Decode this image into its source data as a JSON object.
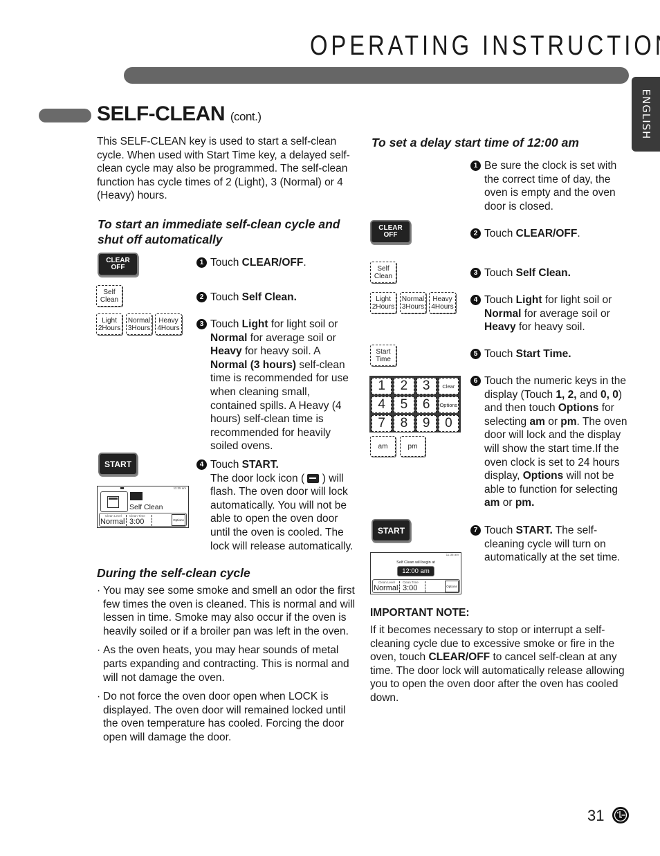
{
  "header": {
    "title": "OPERATING INSTRUCTIONS",
    "language_tab": "ENGLISH"
  },
  "section": {
    "title": "SELF-CLEAN",
    "title_suffix": "(cont.)",
    "intro": "This SELF-CLEAN key is used to start a self-clean cycle. When used with Start Time key, a delayed self-clean cycle may also be programmed. The self-clean function has cycle times of 2 (Light), 3 (Normal) or 4 (Heavy) hours."
  },
  "immediate": {
    "heading": "To start an immediate self-clean cycle and shut off automatically",
    "steps": [
      {
        "num": "1",
        "pre": "Touch ",
        "bold": "CLEAR/OFF",
        "post": "."
      },
      {
        "num": "2",
        "pre": "Touch ",
        "bold": "Self Clean.",
        "post": ""
      },
      {
        "num": "3",
        "html_parts": [
          [
            "",
            "Touch "
          ],
          [
            "b",
            "Light"
          ],
          [
            "",
            " for light soil or "
          ],
          [
            "b",
            "Normal"
          ],
          [
            "",
            " for average soil or "
          ],
          [
            "b",
            "Heavy"
          ],
          [
            "",
            " for heavy soil. A "
          ],
          [
            "b",
            "Normal (3 hours)"
          ],
          [
            "",
            " self-clean time is recommended for use when cleaning small, contained spills. A Heavy (4 hours) self-clean time is recommended for heavily soiled ovens."
          ]
        ]
      },
      {
        "num": "4",
        "line1_pre": "Touch ",
        "line1_bold": "START.",
        "body_pre": "The door lock icon ( ",
        "body_post": " ) will flash. The oven door will lock automatically. You will not be able to open the oven door until the oven is cooled. The lock will release automatically."
      }
    ],
    "buttons": {
      "clear_off": [
        "CLEAR",
        "OFF"
      ],
      "self_clean": [
        "Self",
        "Clean"
      ],
      "light": [
        "Light",
        "2Hours"
      ],
      "normal": [
        "Normal",
        "3Hours"
      ],
      "heavy": [
        "Heavy",
        "4Hours"
      ],
      "start": "START"
    },
    "display": {
      "clock": "11:35 am",
      "mode": "Self Clean",
      "clean_level_label": "Clean Level",
      "clean_level": "Normal",
      "clean_time_label": "Clean Time",
      "clean_time": "3:00",
      "options": "Options"
    }
  },
  "during": {
    "heading": "During the self-clean cycle",
    "bullets": [
      "You may see some smoke and smell an odor the first few times the oven is cleaned. This is normal and will lessen in time. Smoke may also occur if the oven is heavily soiled or if a broiler pan was left in the oven.",
      "As the oven heats, you may hear sounds of metal parts expanding and contracting. This is normal and will not damage the oven.",
      "Do not force the oven door open when LOCK is displayed. The oven door will remained locked until the oven temperature has cooled. Forcing the door open will damage the door."
    ]
  },
  "delay": {
    "heading": "To set a delay start time of 12:00 am",
    "steps": [
      {
        "num": "1",
        "parts": [
          [
            "",
            "Be sure the clock is set with the correct time of day, the oven is empty and the oven door is closed."
          ]
        ]
      },
      {
        "num": "2",
        "parts": [
          [
            "",
            "Touch "
          ],
          [
            "b",
            "CLEAR/OFF"
          ],
          [
            "",
            "."
          ]
        ]
      },
      {
        "num": "3",
        "parts": [
          [
            "",
            "Touch "
          ],
          [
            "b",
            "Self Clean."
          ]
        ]
      },
      {
        "num": "4",
        "parts": [
          [
            "",
            "Touch "
          ],
          [
            "b",
            "Light"
          ],
          [
            "",
            " for light soil or "
          ],
          [
            "b",
            "Normal"
          ],
          [
            "",
            " for average soil or "
          ],
          [
            "b",
            "Heavy"
          ],
          [
            "",
            " for heavy soil."
          ]
        ]
      },
      {
        "num": "5",
        "parts": [
          [
            "",
            "Touch "
          ],
          [
            "b",
            "Start Time."
          ]
        ]
      },
      {
        "num": "6",
        "parts": [
          [
            "",
            "Touch the numeric keys in the display (Touch "
          ],
          [
            "b",
            "1, 2,"
          ],
          [
            "",
            " and "
          ],
          [
            "b",
            "0, 0"
          ],
          [
            "",
            ") and then touch "
          ],
          [
            "b",
            "Options"
          ],
          [
            "",
            " for selecting "
          ],
          [
            "b",
            "am"
          ],
          [
            "",
            " or "
          ],
          [
            "b",
            "pm"
          ],
          [
            "",
            ". The oven door will lock and the display will show the start time.If the oven clock is set to 24 hours display, "
          ],
          [
            "b",
            "Options"
          ],
          [
            "",
            " will not be able to function for selecting "
          ],
          [
            "b",
            "am"
          ],
          [
            "",
            " or "
          ],
          [
            "b",
            "pm."
          ]
        ]
      },
      {
        "num": "7",
        "parts": [
          [
            "",
            "Touch "
          ],
          [
            "b",
            "START."
          ],
          [
            "",
            " The self-cleaning cycle will turn on automatically at the set time."
          ]
        ]
      }
    ],
    "buttons": {
      "clear_off": [
        "CLEAR",
        "OFF"
      ],
      "self_clean": [
        "Self",
        "Clean"
      ],
      "light": [
        "Light",
        "2Hours"
      ],
      "normal": [
        "Normal",
        "3Hours"
      ],
      "heavy": [
        "Heavy",
        "4Hours"
      ],
      "start_time": [
        "Start",
        "Time"
      ],
      "start": "START",
      "keypad": [
        "1",
        "2",
        "3",
        "Clear",
        "4",
        "5",
        "6",
        "Options",
        "7",
        "8",
        "9",
        "0"
      ],
      "am": "am",
      "pm": "pm"
    },
    "display": {
      "clock": "11:35 am",
      "message": "Self Clean will begin at",
      "start_time": "12:00 am",
      "clean_level_label": "Clean Level",
      "clean_level": "Normal",
      "clean_time_label": "Clean Time",
      "clean_time": "3:00",
      "options": "Options"
    }
  },
  "important": {
    "heading": "IMPORTANT NOTE:",
    "parts": [
      [
        "",
        "If it becomes necessary to stop or interrupt a self-cleaning cycle due to excessive smoke or fire in the oven, touch "
      ],
      [
        "b",
        "CLEAR/OFF"
      ],
      [
        "",
        " to cancel self-clean at any time. The door lock will automatically release allowing you to open the oven door after the oven has cooled down."
      ]
    ]
  },
  "footer": {
    "page_number": "31",
    "logo": "lg-logo"
  }
}
